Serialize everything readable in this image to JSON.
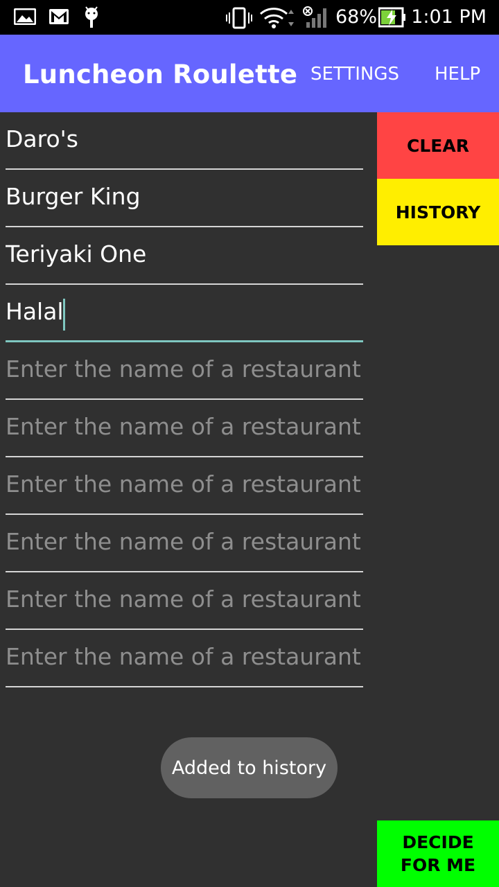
{
  "status_bar": {
    "battery_percent": "68%",
    "time": "1:01 PM",
    "icons": [
      "gallery-icon",
      "gmail-icon",
      "android-debug-icon",
      "vibrate-icon",
      "wifi-icon",
      "signal-icon",
      "battery-charging-icon"
    ]
  },
  "app_bar": {
    "title": "Luncheon Roulette",
    "menu": {
      "settings": "SETTINGS",
      "help": "HELP"
    },
    "color": "#6666ff"
  },
  "restaurants": {
    "placeholder": "Enter the name of a restaurant...",
    "values": [
      "Daro's",
      "Burger King",
      "Teriyaki One",
      "Halal",
      "",
      "",
      "",
      "",
      "",
      ""
    ]
  },
  "buttons": {
    "clear": "CLEAR",
    "history": "HISTORY",
    "decide_line1": "DECIDE",
    "decide_line2": "FOR ME"
  },
  "toast": {
    "message": "Added to history"
  },
  "colors": {
    "background": "#303030",
    "clear": "#ff4444",
    "history": "#ffee00",
    "decide": "#00ff00",
    "accent": "#7fc7c0"
  }
}
